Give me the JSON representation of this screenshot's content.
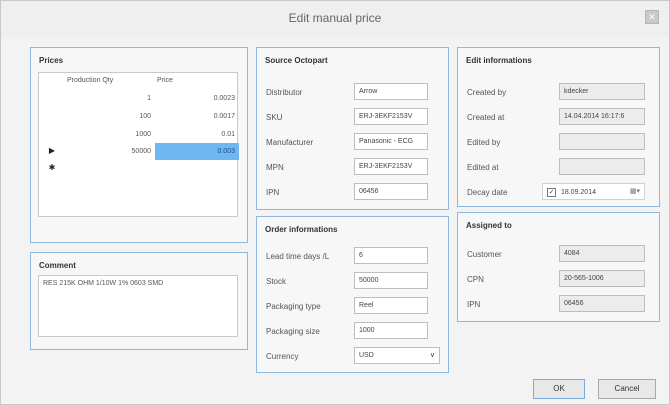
{
  "window": {
    "title": "Edit manual price",
    "close_glyph": "✕"
  },
  "prices": {
    "title": "Prices",
    "columns": [
      "Production Qty",
      "Price"
    ],
    "rows": [
      {
        "qty": "1",
        "price": "0.0023"
      },
      {
        "qty": "100",
        "price": "0.0017"
      },
      {
        "qty": "1000",
        "price": "0.01"
      },
      {
        "qty": "50000",
        "price": "0.003"
      }
    ],
    "row_markers": [
      "▶",
      "✱"
    ]
  },
  "comment": {
    "title": "Comment",
    "text": "RES 215K OHM 1/10W 1% 0603 SMD"
  },
  "source": {
    "title": "Source Octopart",
    "fields": [
      {
        "label": "Distributor",
        "value": "Arrow"
      },
      {
        "label": "SKU",
        "value": "ERJ-3EKF2153V"
      },
      {
        "label": "Manufacturer",
        "value": "Panasonic - ECG"
      },
      {
        "label": "MPN",
        "value": "ERJ-3EKF2153V"
      },
      {
        "label": "IPN",
        "value": "06456"
      }
    ]
  },
  "order": {
    "title": "Order informations",
    "fields": [
      {
        "label": "Lead time days /L",
        "value": "6"
      },
      {
        "label": "Stock",
        "value": "50000"
      },
      {
        "label": "Packaging type",
        "value": "Reel"
      },
      {
        "label": "Packaging size",
        "value": "1000"
      },
      {
        "label": "Currency",
        "value": "USD"
      }
    ],
    "currency_arrow": "∨"
  },
  "edit": {
    "title": "Edit informations",
    "fields": [
      {
        "label": "Created by",
        "value": "kdecker"
      },
      {
        "label": "Created at",
        "value": "14.04.2014 16:17:6"
      },
      {
        "label": "Edited by",
        "value": ""
      },
      {
        "label": "Edited at",
        "value": ""
      },
      {
        "label": "Decay date",
        "value": "18.09.2014"
      }
    ],
    "checkbox_glyph": "✓",
    "calendar_glyph": "▦▾"
  },
  "assigned": {
    "title": "Assigned to",
    "fields": [
      {
        "label": "Customer",
        "value": "4084"
      },
      {
        "label": "CPN",
        "value": "20-565-1006"
      },
      {
        "label": "IPN",
        "value": "06456"
      }
    ]
  },
  "buttons": {
    "ok": "OK",
    "cancel": "Cancel"
  }
}
